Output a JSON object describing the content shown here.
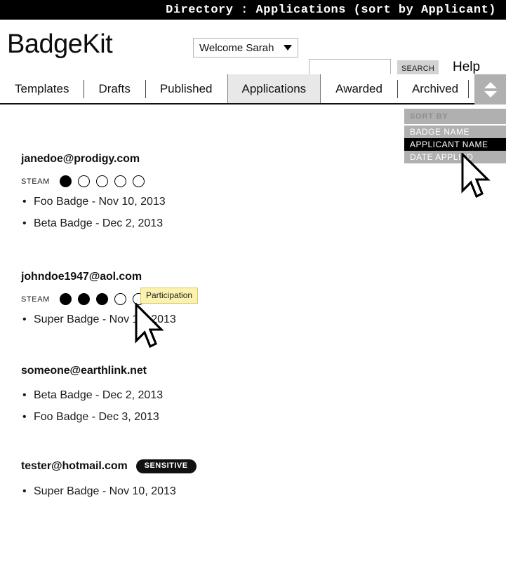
{
  "titlebar": {
    "text": "Directory : Applications (sort by Applicant)"
  },
  "masthead": {
    "logo": "BadgeKit",
    "user_menu": {
      "label": "Welcome Sarah",
      "caret_icon": "chevron-down-icon"
    },
    "search": {
      "value": "",
      "placeholder": "",
      "button_label": "SEARCH",
      "icon": "search-icon"
    },
    "help_label": "Help"
  },
  "tabs": [
    {
      "label": "Templates",
      "active": false
    },
    {
      "label": "Drafts",
      "active": false
    },
    {
      "label": "Published",
      "active": false
    },
    {
      "label": "Applications",
      "active": true
    },
    {
      "label": "Awarded",
      "active": false
    },
    {
      "label": "Archived",
      "active": false
    }
  ],
  "sort_toggle": {
    "up_icon": "triangle-up-icon",
    "down_icon": "triangle-down-icon"
  },
  "sort_panel": {
    "heading": "SORT BY",
    "items": [
      {
        "label": "BADGE NAME",
        "selected": false
      },
      {
        "label": "APPLICANT NAME",
        "selected": true
      },
      {
        "label": "DATE APPLIED",
        "selected": false
      }
    ]
  },
  "applicants": [
    {
      "email": "janedoe@prodigy.com",
      "tag": null,
      "steam": {
        "label": "STEAM",
        "total": 5,
        "filled": 1
      },
      "badges": [
        {
          "bullet": "•",
          "text": "Foo Badge - Nov 10, 2013"
        },
        {
          "bullet": "•",
          "text": "Beta Badge - Dec 2, 2013"
        }
      ]
    },
    {
      "email": "johndoe1947@aol.com",
      "tag": null,
      "steam": {
        "label": "STEAM",
        "total": 5,
        "filled": 3
      },
      "badges": [
        {
          "bullet": "•",
          "text": "Super Badge - Nov 10, 2013"
        }
      ]
    },
    {
      "email": "someone@earthlink.net",
      "tag": null,
      "steam": null,
      "badges": [
        {
          "bullet": "•",
          "text": "Beta Badge - Dec 2, 2013"
        },
        {
          "bullet": "•",
          "text": "Foo Badge - Dec 3, 2013"
        }
      ]
    },
    {
      "email": "tester@hotmail.com",
      "tag": "SENSITIVE",
      "steam": null,
      "badges": [
        {
          "bullet": "•",
          "text": "Super Badge - Nov 10, 2013"
        }
      ]
    }
  ],
  "tooltip": {
    "text": "Participation"
  },
  "colors": {
    "titlebar_bg": "#000000",
    "tab_active_bg": "#e8e8e8",
    "sort_panel_bg": "#b0b0b0",
    "sort_selected_bg": "#000000",
    "tooltip_bg": "#fbf2b0",
    "tooltip_border": "#d8c96a",
    "search_button_bg": "#d2d2d2",
    "pill_bg": "#111111"
  }
}
